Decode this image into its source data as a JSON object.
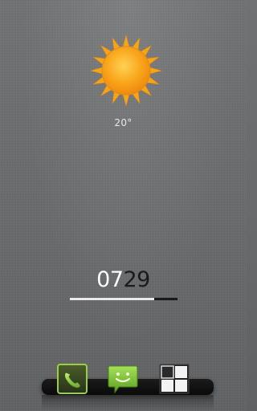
{
  "weather": {
    "icon": "sun-icon",
    "temperature": "20°"
  },
  "clock": {
    "bright_digits": "07",
    "dim_digits": "29",
    "seconds_progress": 0.78
  },
  "dock": {
    "items": [
      {
        "name": "phone",
        "icon": "phone-icon"
      },
      {
        "name": "messaging",
        "icon": "sms-icon"
      },
      {
        "name": "app-drawer",
        "icon": "app-grid-icon"
      }
    ]
  },
  "colors": {
    "sun": "#f7a81b",
    "phone_green": "#6ea62c",
    "sms_green": "#7ec33a",
    "background": "#6d6f71"
  }
}
